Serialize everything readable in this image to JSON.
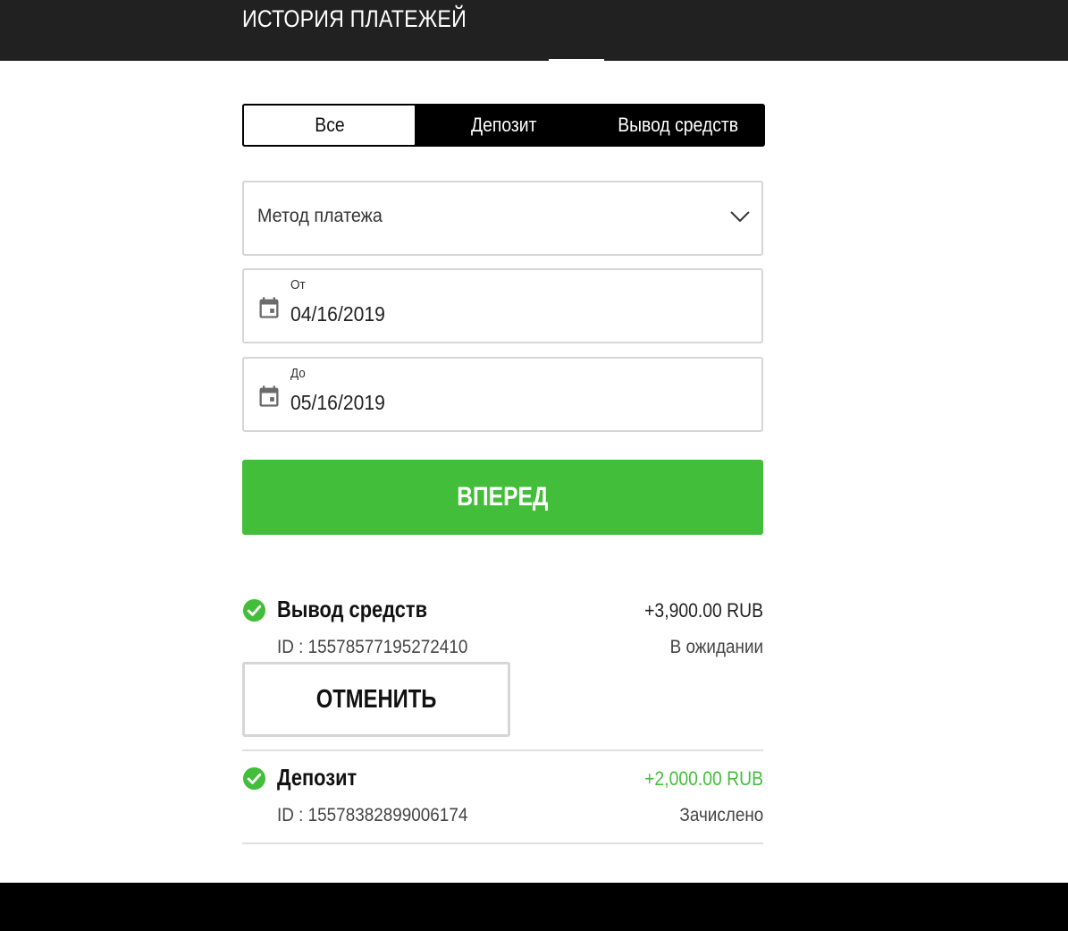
{
  "header": {
    "title": "ИСТОРИЯ ПЛАТЕЖЕЙ"
  },
  "tabs": [
    {
      "label": "Все",
      "active": true
    },
    {
      "label": "Депозит",
      "active": false
    },
    {
      "label": "Вывод средств",
      "active": false
    }
  ],
  "filters": {
    "payment_method": {
      "value": "Метод платежа",
      "icon": "chevron-down-icon"
    },
    "date_from": {
      "label": "От",
      "value": "04/16/2019",
      "icon": "calendar-icon"
    },
    "date_to": {
      "label": "До",
      "value": "05/16/2019",
      "icon": "calendar-icon"
    }
  },
  "submit": {
    "label": "ВПЕРЕД"
  },
  "transactions": [
    {
      "type": "Вывод средств",
      "amount": "+3,900.00 RUB",
      "id": "ID : 15578577195272410",
      "status": "В ожидании",
      "cancel_label": "ОТМЕНИТЬ",
      "icon": "check-circle-icon"
    },
    {
      "type": "Депозит",
      "amount": "+2,000.00 RUB",
      "id": "ID : 15578382899006174",
      "status": "Зачислено",
      "icon": "check-circle-icon"
    }
  ],
  "colors": {
    "accent_green": "#43be3a",
    "header_bg": "#212121",
    "tabs_bg": "#000000",
    "border": "#d6d6d6"
  }
}
